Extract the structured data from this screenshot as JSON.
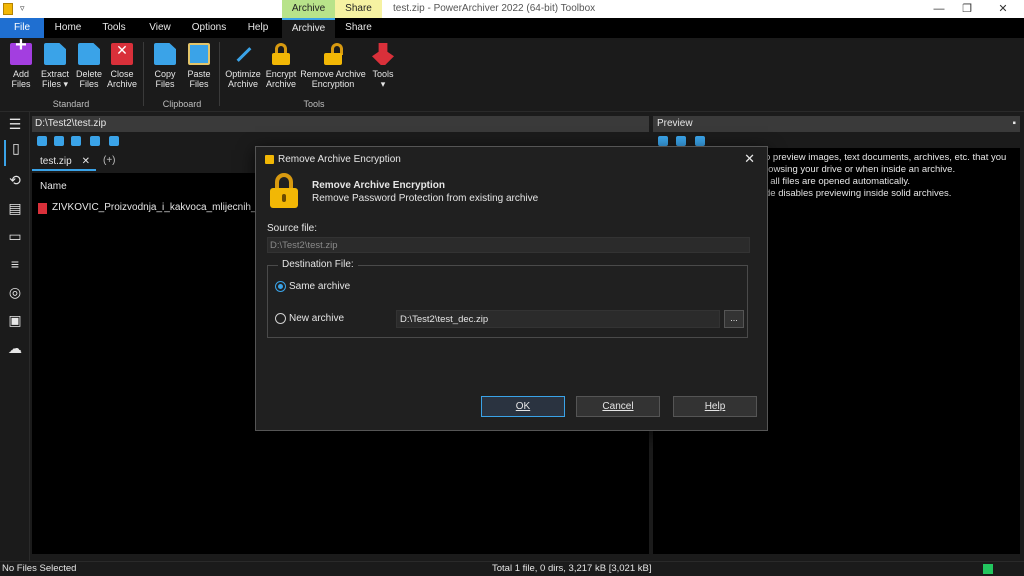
{
  "titlebar": {
    "title": "test.zip - PowerArchiver 2022 (64-bit) Toolbox",
    "context_tabs": [
      "Archive",
      "Share"
    ],
    "qat": "▿"
  },
  "tabs": [
    "File",
    "Home",
    "Tools",
    "View",
    "Options",
    "Help",
    "Archive",
    "Share"
  ],
  "ribbon": {
    "groups": [
      {
        "label": "Standard",
        "buttons": [
          {
            "label1": "Add",
            "label2": "Files"
          },
          {
            "label1": "Extract",
            "label2": "Files ▾"
          },
          {
            "label1": "Delete",
            "label2": "Files"
          },
          {
            "label1": "Close",
            "label2": "Archive"
          }
        ]
      },
      {
        "label": "Clipboard",
        "buttons": [
          {
            "label1": "Copy",
            "label2": "Files"
          },
          {
            "label1": "Paste",
            "label2": "Files"
          }
        ]
      },
      {
        "label": "Tools",
        "buttons": [
          {
            "label1": "Optimize",
            "label2": "Archive"
          },
          {
            "label1": "Encrypt",
            "label2": "Archive"
          },
          {
            "label1": "Remove Archive",
            "label2": "Encryption"
          },
          {
            "label1": "Tools",
            "label2": "▾"
          }
        ]
      }
    ]
  },
  "main": {
    "path": "D:\\Test2\\test.zip",
    "doc_tab": "test.zip",
    "doc_tab_close": "✕",
    "new_tab": "(+)",
    "column_name": "Name",
    "file": "ZIVKOVIC_Proizvodnja_i_kakvoca_mlijecnih_proi"
  },
  "preview": {
    "title": "Preview",
    "pin": "▪",
    "lines": [
      "o preview images, text documents, archives, etc. that you",
      "rowsing your drive or when inside an archive.",
      "t all files are opened automatically.",
      "de disables previewing inside solid archives."
    ]
  },
  "status": {
    "left": "No Files Selected",
    "right": "Total 1 file, 0 dirs, 3,217 kB [3,021 kB]"
  },
  "dialog": {
    "title": "Remove Archive Encryption",
    "close": "✕",
    "heading": "Remove Archive Encryption",
    "subheading": "Remove Password Protection from existing archive",
    "source_label": "Source file:",
    "source_value": "D:\\Test2\\test.zip",
    "dest_legend": "Destination File:",
    "option_same": "Same archive",
    "option_new": "New archive",
    "new_archive_path": "D:\\Test2\\test_dec.zip",
    "browse": "...",
    "ok": "OK",
    "cancel": "Cancel",
    "help": "Help"
  },
  "colors": {
    "accent": "#3aa3e8",
    "file_tab": "#1f6fd1",
    "context_archive": "#b8e38a",
    "context_share": "#f6f2a2",
    "lock": "#f2b705"
  }
}
